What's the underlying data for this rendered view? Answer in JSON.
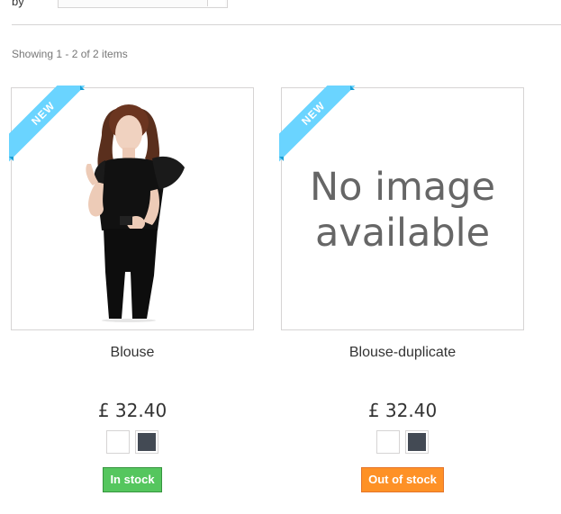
{
  "toolbar": {
    "sort_label": "by",
    "sort_value": ""
  },
  "listing": {
    "showing_text": "Showing 1 - 2 of 2 items"
  },
  "products": [
    {
      "badge": "NEW",
      "image": "product-photo-woman-black-blouse",
      "name": "Blouse",
      "price": "£ 32.40",
      "swatches": [
        {
          "name": "white",
          "color": "#ffffff"
        },
        {
          "name": "dark-grey",
          "color": "#434a54"
        }
      ],
      "availability": "In stock",
      "availability_color": "#55c65e"
    },
    {
      "badge": "NEW",
      "image_placeholder_line1": "No image",
      "image_placeholder_line2": "available",
      "name": "Blouse-duplicate",
      "price": "£ 32.40",
      "swatches": [
        {
          "name": "white",
          "color": "#ffffff"
        },
        {
          "name": "dark-grey",
          "color": "#434a54"
        }
      ],
      "availability": "Out of stock",
      "availability_color": "#fe9126"
    }
  ],
  "colors": {
    "ribbon": "#6ad4ff",
    "ribbon_fold": "#1ca0d6",
    "border": "#d6d4d4"
  }
}
